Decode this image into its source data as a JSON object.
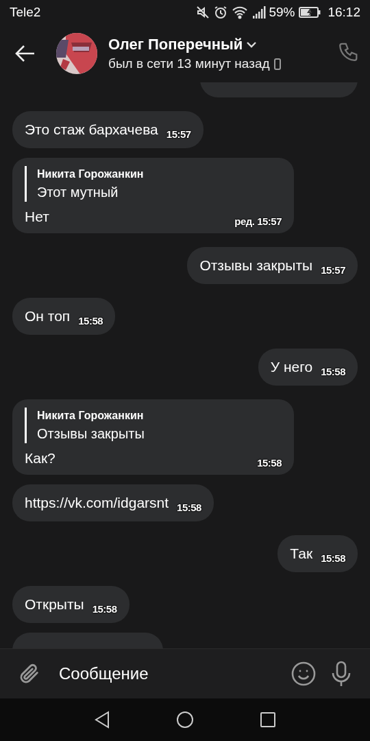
{
  "status_bar": {
    "carrier": "Tele2",
    "battery": "59%",
    "time": "16:12"
  },
  "header": {
    "name": "Олег Поперечный",
    "status": "был в сети 13 минут назад"
  },
  "messages": [
    {
      "kind": "outgoing"
    },
    {
      "kind": "incoming",
      "text": "Это стаж бархачева",
      "time": "15:57"
    },
    {
      "kind": "incoming",
      "reply": {
        "author": "Никита Горожанкин",
        "text": "Этот мутный"
      },
      "text": "Нет",
      "time": "ред. 15:57"
    },
    {
      "kind": "outgoing",
      "text": "Отзывы закрыты",
      "time": "15:57"
    },
    {
      "kind": "incoming",
      "text": "Он топ",
      "time": "15:58"
    },
    {
      "kind": "outgoing",
      "text": "У него",
      "time": "15:58"
    },
    {
      "kind": "incoming",
      "reply": {
        "author": "Никита Горожанкин",
        "text": "Отзывы закрыты"
      },
      "text": "Как?",
      "time": "15:58"
    },
    {
      "kind": "incoming",
      "text": "https://vk.com/idgarsnt",
      "time": "15:58"
    },
    {
      "kind": "outgoing",
      "text": "Так",
      "time": "15:58"
    },
    {
      "kind": "incoming",
      "text": "Открыты",
      "time": "15:58"
    },
    {
      "kind": "incoming"
    }
  ],
  "composer": {
    "placeholder": "Сообщение"
  }
}
